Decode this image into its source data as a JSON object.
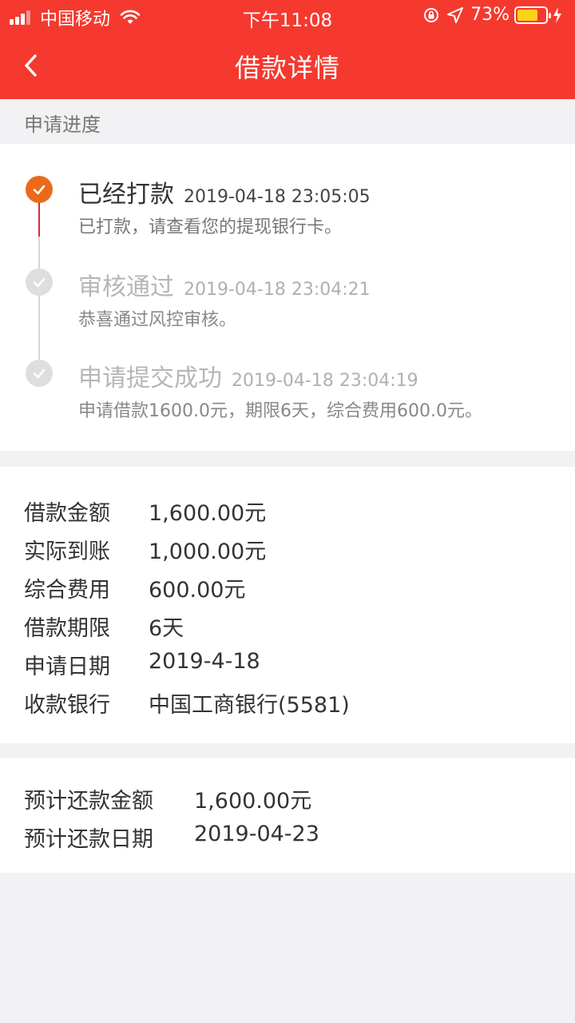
{
  "status_bar": {
    "carrier": "中国移动",
    "time": "下午11:08",
    "battery": "73%",
    "battery_level": 0.73,
    "battery_color": "#ffd21a"
  },
  "header": {
    "title": "借款详情",
    "color": "#f5392e"
  },
  "progress": {
    "section_label": "申请进度",
    "steps": [
      {
        "name": "已经打款",
        "timestamp": "2019-04-18 23:05:05",
        "description": "已打款，请查看您的提现银行卡。",
        "state": "active"
      },
      {
        "name": "审核通过",
        "timestamp": "2019-04-18 23:04:21",
        "description": "恭喜通过风控审核。",
        "state": "done"
      },
      {
        "name": "申请提交成功",
        "timestamp": "2019-04-18 23:04:19",
        "description": "申请借款1600.0元，期限6天，综合费用600.0元。",
        "state": "done"
      }
    ],
    "active_color": "#ea6a1a",
    "active_line_color": "#e0282c"
  },
  "loan": {
    "rows": [
      {
        "label": "借款金额",
        "value": "1,600.00元"
      },
      {
        "label": "实际到账",
        "value": "1,000.00元"
      },
      {
        "label": "综合费用",
        "value": "600.00元"
      },
      {
        "label": "借款期限",
        "value": "6天"
      },
      {
        "label": "申请日期",
        "value": "2019-4-18"
      },
      {
        "label": "收款银行",
        "value": "中国工商银行(5581)"
      }
    ]
  },
  "repayment": {
    "rows": [
      {
        "label": "预计还款金额",
        "value": "1,600.00元"
      },
      {
        "label": "预计还款日期",
        "value": "2019-04-23"
      }
    ]
  }
}
